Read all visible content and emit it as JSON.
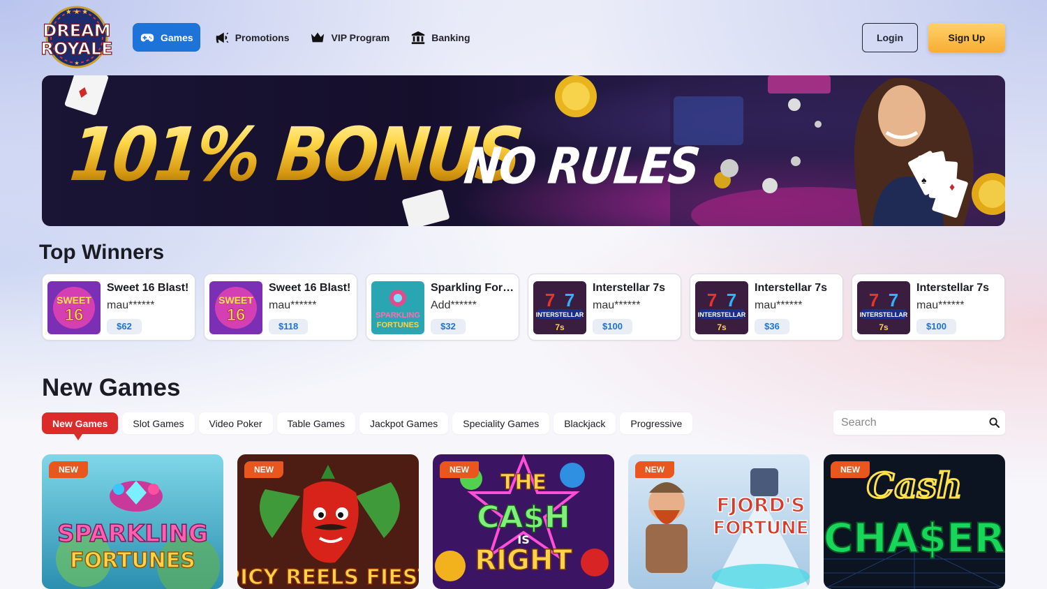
{
  "header": {
    "logo": {
      "line1": "DREAM",
      "line2": "ROYALE"
    },
    "nav": [
      {
        "label": "Games",
        "icon": "gamepad-icon",
        "active": true
      },
      {
        "label": "Promotions",
        "icon": "megaphone-icon",
        "active": false
      },
      {
        "label": "VIP Program",
        "icon": "crown-icon",
        "active": false
      },
      {
        "label": "Banking",
        "icon": "bank-icon",
        "active": false
      }
    ],
    "login_label": "Login",
    "signup_label": "Sign Up"
  },
  "banner": {
    "headline": "101% BONUS",
    "subline": "NO RULES"
  },
  "top_winners": {
    "title": "Top Winners",
    "items": [
      {
        "game": "Sweet 16 Blast!",
        "user": "mau******",
        "amount": "$62"
      },
      {
        "game": "Sweet 16 Blast!",
        "user": "mau******",
        "amount": "$118"
      },
      {
        "game": "Sparkling Fortunes",
        "user": "Add******",
        "amount": "$32"
      },
      {
        "game": "Interstellar 7s",
        "user": "mau******",
        "amount": "$100"
      },
      {
        "game": "Interstellar 7s",
        "user": "mau******",
        "amount": "$36"
      },
      {
        "game": "Interstellar 7s",
        "user": "mau******",
        "amount": "$100"
      }
    ]
  },
  "new_games": {
    "title": "New Games",
    "tabs": [
      "New Games",
      "Slot Games",
      "Video Poker",
      "Table Games",
      "Jackpot Games",
      "Speciality Games",
      "Blackjack",
      "Progressive"
    ],
    "active_tab": "New Games",
    "search_placeholder": "Search",
    "cards": [
      {
        "badge": "NEW",
        "title": "SPARKLING FORTUNES"
      },
      {
        "badge": "NEW",
        "title": "SPICY REELS FIESTA"
      },
      {
        "badge": "NEW",
        "title": "THE CASH IS RIGHT"
      },
      {
        "badge": "NEW",
        "title": "FJORD'S FORTUNE"
      },
      {
        "badge": "NEW",
        "title": "Cash CHASER"
      }
    ]
  },
  "colors": {
    "primary_blue": "#1d73d8",
    "signup_gold": "#f7ad33",
    "active_tab_red": "#dc2b2b",
    "new_badge_orange": "#e9561e"
  }
}
